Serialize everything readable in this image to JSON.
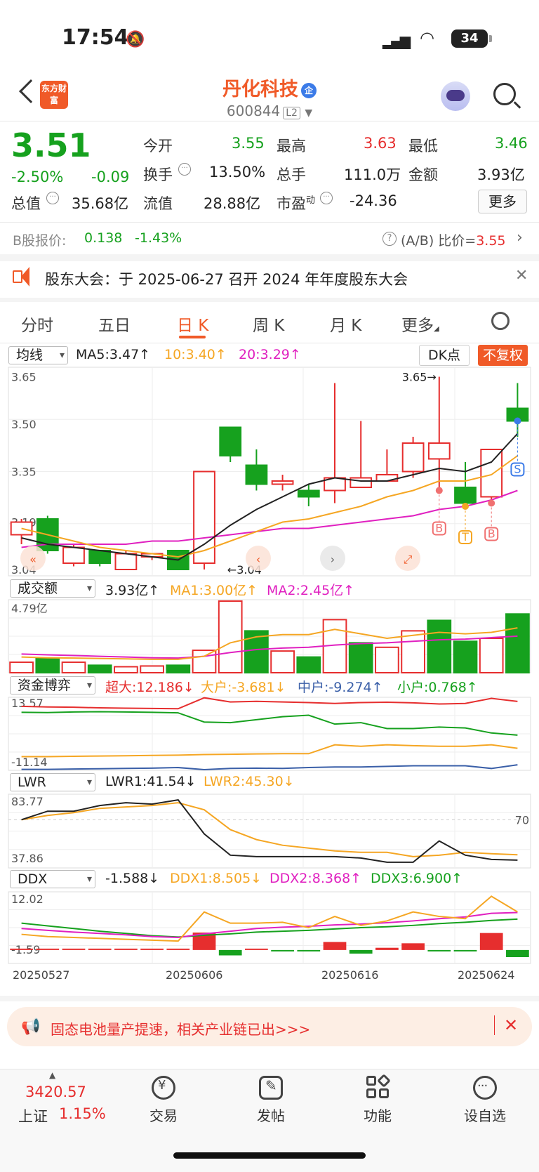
{
  "status": {
    "time": "17:54",
    "battery": "34"
  },
  "header": {
    "logo": "东方财富",
    "name": "丹化科技",
    "badge": "企",
    "code": "600844",
    "level": "L2"
  },
  "quote": {
    "price": "3.51",
    "change_pct": "-2.50%",
    "change": "-0.09",
    "open_label": "今开",
    "open": "3.55",
    "high_label": "最高",
    "high": "3.63",
    "low_label": "最低",
    "low": "3.46",
    "turnover_label": "换手",
    "turnover": "13.50%",
    "volume_label": "总手",
    "volume": "111.0万",
    "amount_label": "金额",
    "amount": "3.93亿",
    "mktcap_label": "总值",
    "mktcap": "35.68亿",
    "float_label": "流值",
    "float": "28.88亿",
    "pe_label": "市盈",
    "pe_sup": "动",
    "pe": "-24.36",
    "more": "更多"
  },
  "bshare": {
    "label": "B股报价:",
    "price": "0.138",
    "pct": "-1.43%",
    "ratio_label": "(A/B) 比价=",
    "ratio": "3.55"
  },
  "notice": {
    "text": "股东大会：于 2025-06-27 召开 2024 年年度股东大会"
  },
  "tabs": [
    "分时",
    "五日",
    "日 K",
    "周 K",
    "月 K",
    "更多"
  ],
  "kline": {
    "selector": "均线",
    "ma5": "MA5:3.47↑",
    "ma10": "10:3.40↑",
    "ma20": "20:3.29↑",
    "dk": "DK点",
    "unadjust": "不复权",
    "y_ticks": [
      "3.65",
      "3.50",
      "3.35",
      "3.19",
      "3.04"
    ],
    "high_mark": "3.65→",
    "low_mark": "←3.04"
  },
  "volume": {
    "selector": "成交额",
    "value": "3.93亿↑",
    "ma1": "MA1:3.00亿↑",
    "ma2": "MA2:2.45亿↑",
    "y_top": "4.79亿"
  },
  "fund": {
    "selector": "资金博弈",
    "super": "超大:12.186↓",
    "large": "大户:-3.681↓",
    "mid": "中户:-9.274↑",
    "small": "小户:0.768↑",
    "y_top": "13.57",
    "y_bottom": "-11.14"
  },
  "lwr": {
    "selector": "LWR",
    "l1": "LWR1:41.54↓",
    "l2": "LWR2:45.30↓",
    "y_top": "83.77",
    "y_bottom": "37.86",
    "ref": "70"
  },
  "ddx": {
    "selector": "DDX",
    "ddx": "-1.588↓",
    "d1": "DDX1:8.505↓",
    "d2": "DDX2:8.368↑",
    "d3": "DDX3:6.900↑",
    "y_top": "12.02",
    "y_bottom": "-1.59"
  },
  "dates": [
    "20250527",
    "20250606",
    "20250616",
    "20250624"
  ],
  "ad": {
    "text": "固态电池量产提速，相关产业链已出>>>"
  },
  "nav": {
    "index_value": "3420.57",
    "index_name": "上证",
    "index_pct": "1.15%",
    "trade": "交易",
    "post": "发帖",
    "func": "功能",
    "watch": "设自选"
  },
  "chart_data": {
    "type": "candlestick",
    "candles": [
      {
        "o": 3.15,
        "c": 3.19,
        "h": 3.2,
        "l": 3.12
      },
      {
        "o": 3.2,
        "c": 3.1,
        "h": 3.21,
        "l": 3.09
      },
      {
        "o": 3.06,
        "c": 3.11,
        "h": 3.12,
        "l": 3.05
      },
      {
        "o": 3.1,
        "c": 3.06,
        "h": 3.1,
        "l": 3.05
      },
      {
        "o": 3.04,
        "c": 3.09,
        "h": 3.1,
        "l": 3.04
      },
      {
        "o": 3.08,
        "c": 3.09,
        "h": 3.09,
        "l": 3.07
      },
      {
        "o": 3.1,
        "c": 3.04,
        "h": 3.1,
        "l": 3.04
      },
      {
        "o": 3.06,
        "c": 3.35,
        "h": 3.35,
        "l": 3.04
      },
      {
        "o": 3.49,
        "c": 3.4,
        "h": 3.49,
        "l": 3.38
      },
      {
        "o": 3.37,
        "c": 3.31,
        "h": 3.42,
        "l": 3.29
      },
      {
        "o": 3.31,
        "c": 3.32,
        "h": 3.34,
        "l": 3.29
      },
      {
        "o": 3.29,
        "c": 3.27,
        "h": 3.31,
        "l": 3.24
      },
      {
        "o": 3.29,
        "c": 3.33,
        "h": 3.63,
        "l": 3.25
      },
      {
        "o": 3.3,
        "c": 3.33,
        "h": 3.51,
        "l": 3.3
      },
      {
        "o": 3.32,
        "c": 3.34,
        "h": 3.42,
        "l": 3.32
      },
      {
        "o": 3.35,
        "c": 3.44,
        "h": 3.46,
        "l": 3.33
      },
      {
        "o": 3.39,
        "c": 3.44,
        "h": 3.65,
        "l": 3.29
      },
      {
        "o": 3.3,
        "c": 3.25,
        "h": 3.38,
        "l": 3.24
      },
      {
        "o": 3.27,
        "c": 3.42,
        "h": 3.42,
        "l": 3.25
      },
      {
        "o": 3.55,
        "c": 3.51,
        "h": 3.63,
        "l": 3.46
      }
    ],
    "ma5": [
      3.14,
      3.12,
      3.11,
      3.1,
      3.09,
      3.08,
      3.07,
      3.12,
      3.18,
      3.23,
      3.27,
      3.31,
      3.33,
      3.32,
      3.32,
      3.34,
      3.36,
      3.35,
      3.38,
      3.47
    ],
    "ma10": [
      3.17,
      3.15,
      3.13,
      3.11,
      3.1,
      3.09,
      3.08,
      3.1,
      3.13,
      3.16,
      3.19,
      3.2,
      3.22,
      3.24,
      3.27,
      3.29,
      3.32,
      3.32,
      3.34,
      3.4
    ],
    "ma20": [
      3.11,
      3.12,
      3.12,
      3.12,
      3.12,
      3.13,
      3.13,
      3.14,
      3.15,
      3.16,
      3.17,
      3.17,
      3.18,
      3.19,
      3.2,
      3.21,
      3.23,
      3.24,
      3.26,
      3.29
    ],
    "volume": [
      0.7,
      0.95,
      0.7,
      0.5,
      0.4,
      0.45,
      0.5,
      1.5,
      4.79,
      2.8,
      1.45,
      1.05,
      3.55,
      2.0,
      1.7,
      2.8,
      3.5,
      2.1,
      2.3,
      3.93
    ],
    "volume_up": [
      true,
      false,
      true,
      false,
      true,
      true,
      false,
      true,
      true,
      false,
      true,
      false,
      true,
      false,
      true,
      true,
      false,
      false,
      true,
      false
    ],
    "vol_ma1": [
      1.05,
      1.0,
      0.98,
      0.95,
      0.93,
      0.9,
      0.9,
      1.1,
      2.0,
      2.4,
      2.55,
      2.55,
      2.9,
      2.6,
      2.3,
      2.5,
      2.7,
      2.6,
      2.7,
      3.0
    ],
    "vol_ma2": [
      1.25,
      1.2,
      1.15,
      1.1,
      1.05,
      1.0,
      0.98,
      1.1,
      1.35,
      1.55,
      1.65,
      1.7,
      1.85,
      1.95,
      2.0,
      2.1,
      2.2,
      2.25,
      2.35,
      2.45
    ],
    "fund_super": [
      10.5,
      10.3,
      10.2,
      10.0,
      9.9,
      9.8,
      9.7,
      13.4,
      12.0,
      12.2,
      12.0,
      11.8,
      11.5,
      11.8,
      11.9,
      11.7,
      11.3,
      11.5,
      13.2,
      12.186
    ],
    "fund_small": [
      8.5,
      8.4,
      8.6,
      8.7,
      8.6,
      8.5,
      8.3,
      5.2,
      5.0,
      6.0,
      7.0,
      7.5,
      4.5,
      5.0,
      3.0,
      3.0,
      3.5,
      3.2,
      1.5,
      0.768
    ],
    "fund_large": [
      -6.5,
      -6.5,
      -6.4,
      -6.3,
      -6.2,
      -6.1,
      -6.0,
      -5.8,
      -5.7,
      -5.6,
      -5.5,
      -5.5,
      -2.5,
      -3.0,
      -2.5,
      -2.8,
      -3.0,
      -3.0,
      -2.5,
      -3.681
    ],
    "fund_mid": [
      -10.8,
      -10.8,
      -10.7,
      -10.6,
      -10.5,
      -10.4,
      -10.2,
      -10.9,
      -10.5,
      -10.4,
      -10.5,
      -10.2,
      -10.0,
      -10.0,
      -9.8,
      -9.6,
      -9.6,
      -9.6,
      -10.5,
      -9.274
    ],
    "lwr1": [
      70,
      76,
      76,
      80,
      82,
      81,
      84,
      60,
      45,
      44,
      44,
      44,
      44,
      43,
      40,
      40,
      55,
      45,
      42,
      41.54
    ],
    "lwr2": [
      70,
      73,
      75,
      78,
      79,
      80,
      82,
      77,
      63,
      56,
      52,
      50,
      48,
      47,
      47,
      44,
      45,
      47,
      46,
      45.3
    ],
    "ddx_bar": [
      0.0,
      0.0,
      0.0,
      0.0,
      0.0,
      0.0,
      0.0,
      3.9,
      -1.2,
      0.2,
      -0.2,
      -0.2,
      1.8,
      -0.8,
      0.5,
      1.5,
      -0.3,
      -0.3,
      3.8,
      -1.588
    ],
    "ddx1": [
      3.5,
      3.0,
      2.8,
      2.6,
      2.4,
      2.2,
      2.0,
      8.5,
      6.0,
      6.0,
      6.2,
      5.0,
      7.5,
      5.5,
      6.5,
      8.5,
      7.5,
      7.0,
      12.0,
      8.505
    ],
    "ddx2": [
      4.8,
      4.4,
      4.0,
      3.7,
      3.4,
      3.0,
      2.8,
      3.6,
      4.2,
      4.8,
      5.1,
      5.3,
      5.6,
      5.8,
      6.1,
      6.5,
      7.0,
      7.4,
      8.2,
      8.368
    ],
    "ddx3": [
      6.0,
      5.4,
      4.8,
      4.2,
      3.7,
      3.2,
      2.9,
      3.3,
      3.6,
      4.0,
      4.2,
      4.4,
      4.7,
      5.0,
      5.2,
      5.5,
      5.9,
      6.2,
      6.6,
      6.9
    ],
    "signals": [
      {
        "idx": 16,
        "label": "B"
      },
      {
        "idx": 17,
        "label": "T"
      },
      {
        "idx": 18,
        "label": "B"
      },
      {
        "idx": 19,
        "label": "S"
      }
    ],
    "colors": {
      "up": "#e62e2e",
      "down": "#16a11e",
      "ma5": "#222222",
      "ma10": "#f5a623",
      "ma20": "#e020c0",
      "mid": "#3a5fa8"
    }
  }
}
